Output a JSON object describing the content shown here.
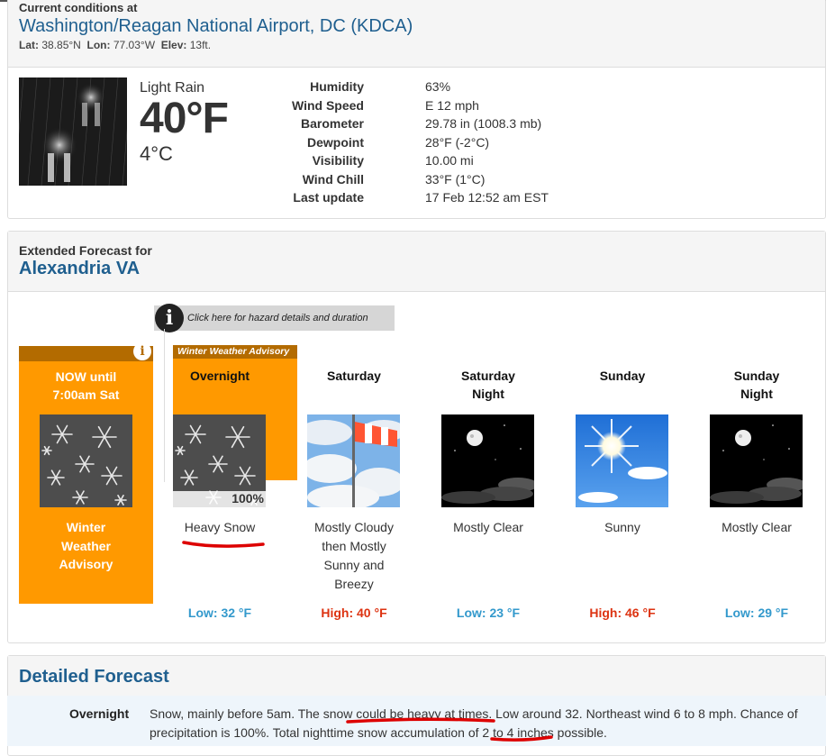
{
  "current": {
    "section_label": "Current conditions at",
    "station": "Washington/Reagan National Airport, DC (KDCA)",
    "lat_label": "Lat:",
    "lat": "38.85°N",
    "lon_label": "Lon:",
    "lon": "77.03°W",
    "elev_label": "Elev:",
    "elev": "13ft.",
    "condition": "Light Rain",
    "temp_f": "40°F",
    "temp_c": "4°C",
    "details": [
      {
        "label": "Humidity",
        "value": "63%"
      },
      {
        "label": "Wind Speed",
        "value": "E 12 mph"
      },
      {
        "label": "Barometer",
        "value": "29.78 in (1008.3 mb)"
      },
      {
        "label": "Dewpoint",
        "value": "28°F (-2°C)"
      },
      {
        "label": "Visibility",
        "value": "10.00 mi"
      },
      {
        "label": "Wind Chill",
        "value": "33°F (1°C)"
      },
      {
        "label": "Last update",
        "value": "17 Feb 12:52 am EST"
      }
    ]
  },
  "extended": {
    "label": "Extended Forecast for",
    "location": "Alexandria VA",
    "hazard_link": "Click here for hazard details and duration",
    "now": {
      "title_line1": "NOW until",
      "title_line2": "7:00am Sat",
      "adv_line1": "Winter",
      "adv_line2": "Weather",
      "adv_line3": "Advisory"
    },
    "advisory_tag": "Winter Weather Advisory",
    "periods": [
      {
        "name1": "Overnight",
        "name2": "",
        "short1": "Heavy Snow",
        "short2": "",
        "short3": "",
        "short4": "",
        "temp": "Low: 32 °F",
        "pop": "100%",
        "icon": "heavy-snow-icon"
      },
      {
        "name1": "Saturday",
        "name2": "",
        "short1": "Mostly Cloudy",
        "short2": "then Mostly",
        "short3": "Sunny and",
        "short4": "Breezy",
        "temp": "High: 40 °F",
        "icon": "windy-cloudy-icon"
      },
      {
        "name1": "Saturday",
        "name2": "Night",
        "short1": "Mostly Clear",
        "short2": "",
        "short3": "",
        "short4": "",
        "temp": "Low: 23 °F",
        "icon": "night-clear-icon"
      },
      {
        "name1": "Sunday",
        "name2": "",
        "short1": "Sunny",
        "short2": "",
        "short3": "",
        "short4": "",
        "temp": "High: 46 °F",
        "icon": "sunny-icon"
      },
      {
        "name1": "Sunday",
        "name2": "Night",
        "short1": "Mostly Clear",
        "short2": "",
        "short3": "",
        "short4": "",
        "temp": "Low: 29 °F",
        "icon": "night-clear-icon"
      }
    ]
  },
  "detailed": {
    "title": "Detailed Forecast",
    "rows": [
      {
        "name": "Overnight",
        "text": "Snow, mainly before 5am. The snow could be heavy at times. Low around 32. Northeast wind 6 to 8 mph. Chance of precipitation is 100%. Total nighttime snow accumulation of 2 to 4 inches possible."
      }
    ]
  },
  "colors": {
    "accent_blue": "#1f5f8f",
    "advisory_orange": "#ff9900",
    "low_temp": "#3399cc",
    "high_temp": "#dd3311",
    "annotation_red": "#dd0000"
  }
}
